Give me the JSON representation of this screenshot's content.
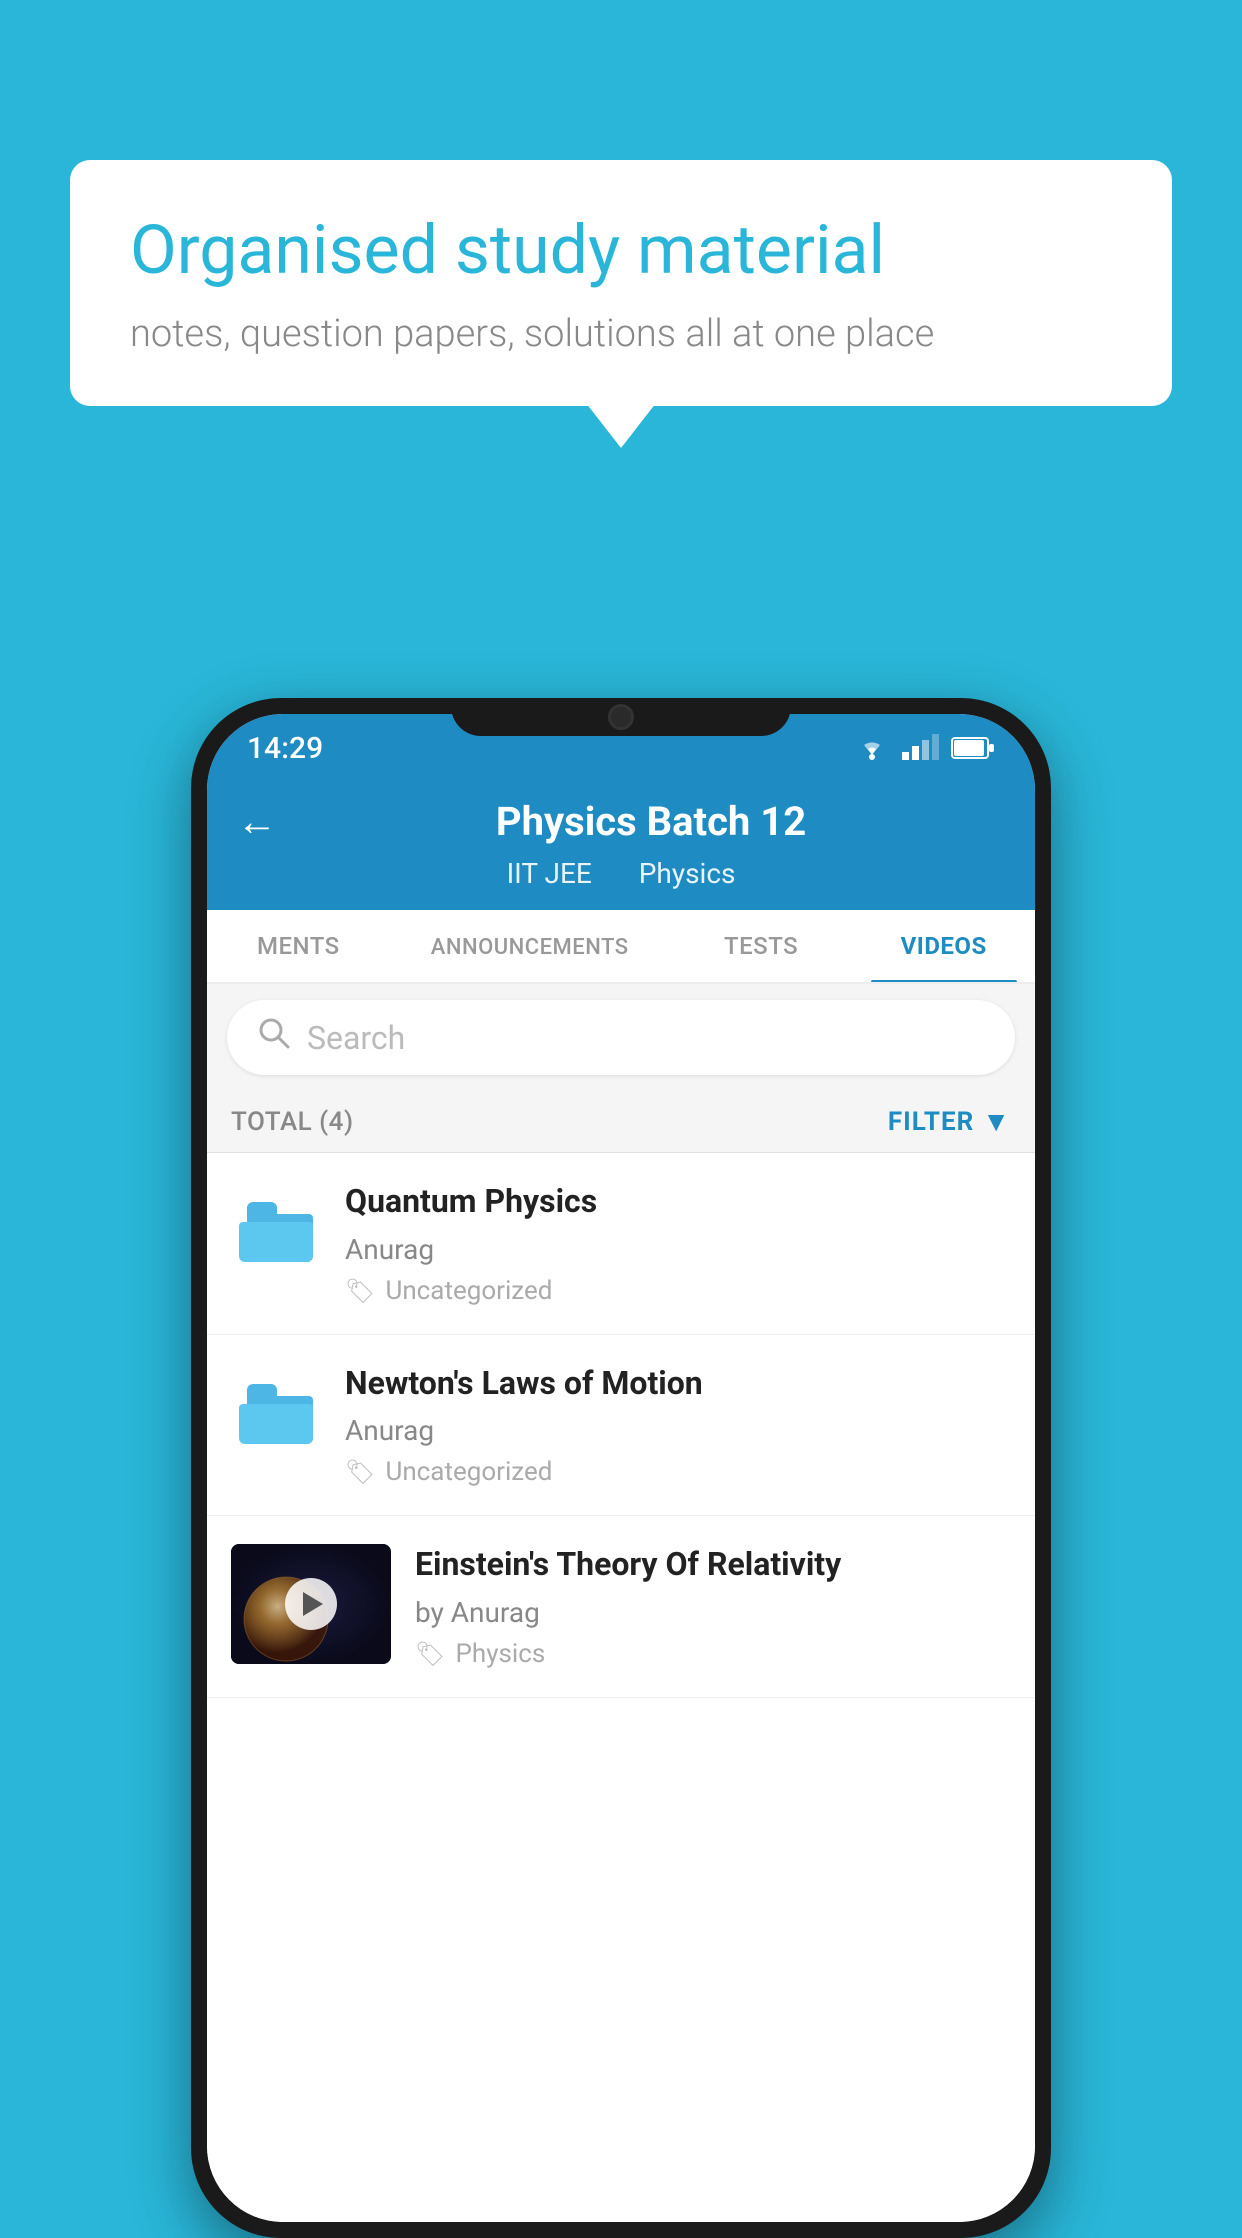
{
  "background": {
    "color": "#29b6d8"
  },
  "speechBubble": {
    "title": "Organised study material",
    "subtitle": "notes, question papers, solutions all at one place"
  },
  "phone": {
    "statusBar": {
      "time": "14:29"
    },
    "appBar": {
      "title": "Physics Batch 12",
      "subtitle1": "IIT JEE",
      "subtitle2": "Physics",
      "backLabel": "←"
    },
    "tabs": [
      {
        "label": "MENTS",
        "active": false
      },
      {
        "label": "ANNOUNCEMENTS",
        "active": false
      },
      {
        "label": "TESTS",
        "active": false
      },
      {
        "label": "VIDEOS",
        "active": true
      }
    ],
    "searchBar": {
      "placeholder": "Search"
    },
    "filterRow": {
      "totalLabel": "TOTAL (4)",
      "filterLabel": "FILTER"
    },
    "videos": [
      {
        "id": 1,
        "title": "Quantum Physics",
        "author": "Anurag",
        "tag": "Uncategorized",
        "hasThumb": false
      },
      {
        "id": 2,
        "title": "Newton's Laws of Motion",
        "author": "Anurag",
        "tag": "Uncategorized",
        "hasThumb": false
      },
      {
        "id": 3,
        "title": "Einstein's Theory Of Relativity",
        "author": "by Anurag",
        "tag": "Physics",
        "hasThumb": true
      }
    ]
  }
}
